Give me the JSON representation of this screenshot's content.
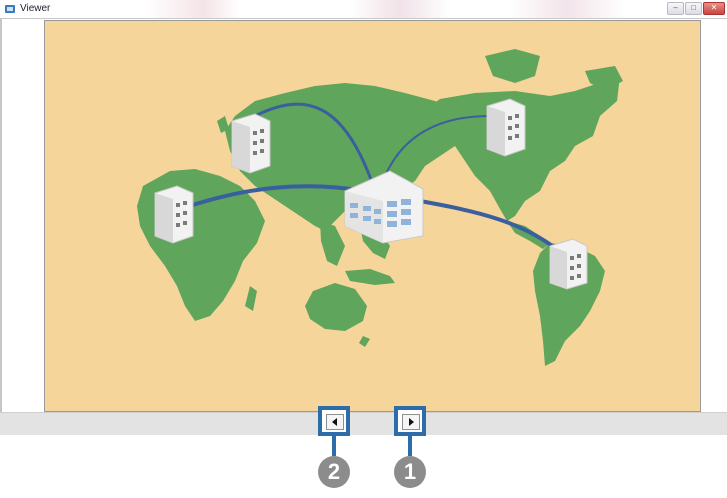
{
  "window": {
    "title": "Viewer",
    "minimize_glyph": "–",
    "maximize_glyph": "□",
    "close_glyph": "✕"
  },
  "map": {
    "icons": [
      "world-map-icon",
      "headquarters-building-icon",
      "office-building-icon"
    ],
    "colors": {
      "background": "#f6d59a",
      "land": "#5fa55b",
      "link": "#3a5f9e"
    }
  },
  "navigation": {
    "previous_icon": "triangle-left-icon",
    "next_icon": "triangle-right-icon"
  },
  "callouts": {
    "previous": "2",
    "next": "1"
  }
}
